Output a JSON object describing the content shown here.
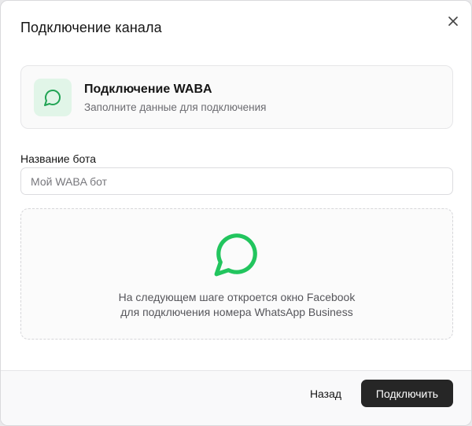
{
  "dialog": {
    "title": "Подключение канала",
    "close_icon": "close-icon"
  },
  "info_card": {
    "icon": "message-circle-icon",
    "title": "Подключение WABA",
    "subtitle": "Заполните данные для подключения"
  },
  "form": {
    "bot_name_label": "Название бота",
    "bot_name_value": "",
    "bot_name_placeholder": "Мой WABA бот"
  },
  "panel": {
    "icon": "message-circle-icon",
    "line1": "На следующем шаге откроется окно Facebook",
    "line2": "для подключения номера WhatsApp Business"
  },
  "footer": {
    "back_label": "Назад",
    "connect_label": "Подключить"
  },
  "colors": {
    "accent_green": "#22c55e",
    "icon_bg": "#e1f5e8",
    "primary_button": "#262626"
  }
}
